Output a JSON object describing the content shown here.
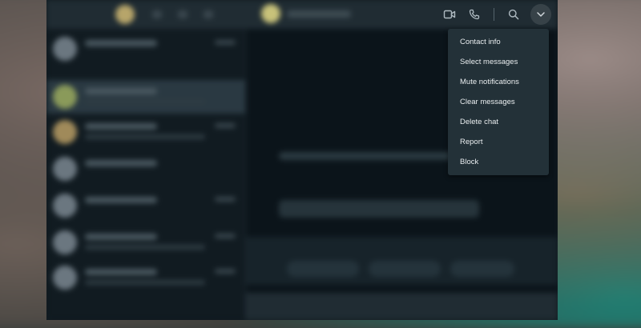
{
  "header": {
    "actions": [
      {
        "name": "video-call-icon"
      },
      {
        "name": "voice-call-icon"
      },
      {
        "name": "search-icon"
      },
      {
        "name": "chevron-down-icon"
      }
    ]
  },
  "menu": {
    "items": [
      {
        "label": "Contact info"
      },
      {
        "label": "Select messages"
      },
      {
        "label": "Mute notifications"
      },
      {
        "label": "Clear messages"
      },
      {
        "label": "Delete chat"
      },
      {
        "label": "Report"
      },
      {
        "label": "Block"
      }
    ]
  },
  "colors": {
    "window_bg": "#111b21",
    "header_bg": "#202c33",
    "menu_bg": "#233138",
    "menu_text": "#e9edef",
    "icon": "#aebac1"
  }
}
